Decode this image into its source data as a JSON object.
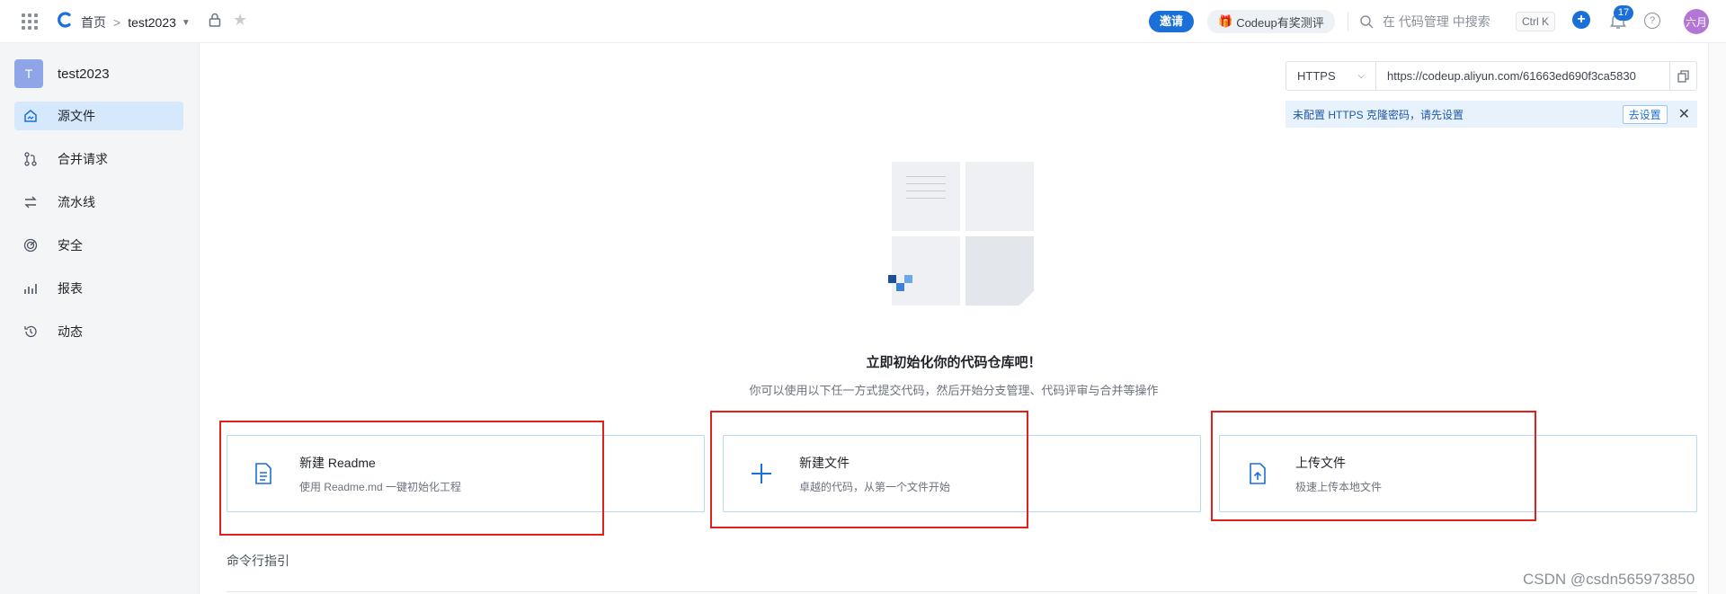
{
  "topbar": {
    "breadcrumb_home": "首页",
    "breadcrumb_sep": ">",
    "repo_name": "test2023",
    "invite_label": "邀请",
    "promo_label": "Codeup有奖测评",
    "search_placeholder": "在 代码管理 中搜索",
    "shortcut": "Ctrl K",
    "notification_count": "17",
    "avatar_text": "六月"
  },
  "sidebar": {
    "project_initial": "T",
    "project_name": "test2023",
    "items": [
      {
        "label": "源文件",
        "icon": "source-files-icon"
      },
      {
        "label": "合并请求",
        "icon": "merge-request-icon"
      },
      {
        "label": "流水线",
        "icon": "pipeline-icon"
      },
      {
        "label": "安全",
        "icon": "security-icon"
      },
      {
        "label": "报表",
        "icon": "report-icon"
      },
      {
        "label": "动态",
        "icon": "history-icon"
      }
    ]
  },
  "clone": {
    "protocol": "HTTPS",
    "url": "https://codeup.aliyun.com/61663ed690f3ca5830",
    "tip_text": "未配置 HTTPS 克隆密码，请先设置",
    "tip_action": "去设置"
  },
  "empty_state": {
    "title": "立即初始化你的代码仓库吧！",
    "subtitle": "你可以使用以下任一方式提交代码，然后开始分支管理、代码评审与合并等操作"
  },
  "cards": [
    {
      "title": "新建 Readme",
      "subtitle": "使用 Readme.md 一键初始化工程",
      "icon": "document-icon"
    },
    {
      "title": "新建文件",
      "subtitle": "卓越的代码，从第一个文件开始",
      "icon": "plus-icon"
    },
    {
      "title": "上传文件",
      "subtitle": "极速上传本地文件",
      "icon": "upload-file-icon"
    }
  ],
  "cli_section_title": "命令行指引",
  "watermark": "CSDN @csdn565973850",
  "colors": {
    "accent": "#1b6fd8",
    "highlight_box": "#e0211b",
    "sidebar_bg": "#f3f5f7",
    "active_nav": "#d6e8fb"
  }
}
